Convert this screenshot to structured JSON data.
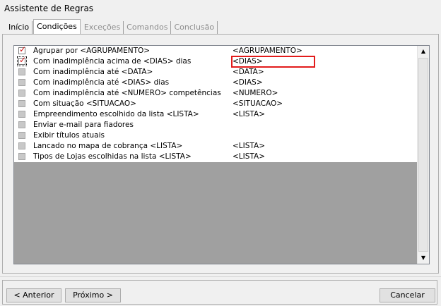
{
  "window": {
    "title": "Assistente de Regras"
  },
  "tabs": [
    {
      "label": "Início",
      "state": "normal"
    },
    {
      "label": "Condições",
      "state": "active"
    },
    {
      "label": "Exceções",
      "state": "disabled"
    },
    {
      "label": "Comandos",
      "state": "disabled"
    },
    {
      "label": "Conclusão",
      "state": "disabled"
    }
  ],
  "conditions": [
    {
      "label": "Agrupar por <AGRUPAMENTO>",
      "value": "<AGRUPAMENTO>",
      "checked": true
    },
    {
      "label": "Com inadimplência acima de <DIAS> dias",
      "value": "<DIAS>",
      "checked": true
    },
    {
      "label": "Com inadimplência até <DATA>",
      "value": "<DATA>",
      "checked": false
    },
    {
      "label": "Com inadimplência até <DIAS>  dias",
      "value": "<DIAS>",
      "checked": false
    },
    {
      "label": "Com inadimplência até <NUMERO> competências",
      "value": "<NUMERO>",
      "checked": false
    },
    {
      "label": "Com situação <SITUACAO>",
      "value": "<SITUACAO>",
      "checked": false
    },
    {
      "label": "Empreendimento escolhido da lista <LISTA>",
      "value": "<LISTA>",
      "checked": false
    },
    {
      "label": "Enviar e-mail para fiadores",
      "value": "",
      "checked": false
    },
    {
      "label": "Exibir títulos atuais",
      "value": "",
      "checked": false
    },
    {
      "label": "Lancado no mapa de cobrança <LISTA>",
      "value": "<LISTA>",
      "checked": false
    },
    {
      "label": "Tipos de Lojas escolhidas na lista <LISTA>",
      "value": "<LISTA>",
      "checked": false
    }
  ],
  "buttons": {
    "prev": "< Anterior",
    "next": "Próximo >",
    "cancel": "Cancelar"
  },
  "icons": {
    "scroll_up": "triangle-up-icon",
    "scroll_down": "triangle-down-icon",
    "check_mark": "checkmark-icon"
  },
  "colors": {
    "highlight": "#e21b1b",
    "check_mark": "#d11313"
  }
}
